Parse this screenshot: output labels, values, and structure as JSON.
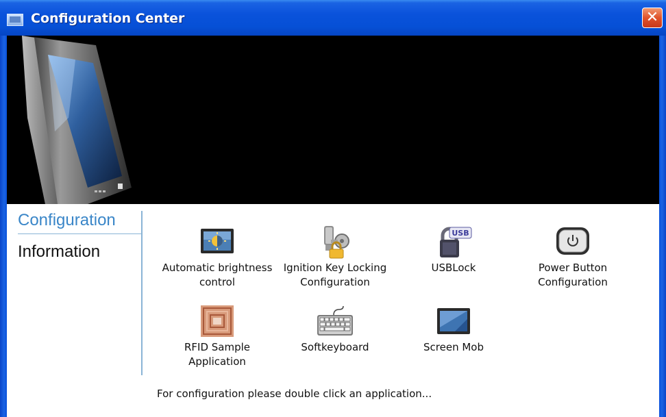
{
  "window": {
    "title": "Configuration Center",
    "close_glyph": "✕"
  },
  "nav": {
    "configuration": "Configuration",
    "information": "Information"
  },
  "apps": [
    {
      "label": "Automatic brightness\ncontrol",
      "icon": "brightness-icon"
    },
    {
      "label": "Ignition Key Locking\nConfiguration",
      "icon": "ignition-key-icon"
    },
    {
      "label": "USBLock",
      "icon": "usb-lock-icon"
    },
    {
      "label": "Power Button\nConfiguration",
      "icon": "power-button-icon"
    },
    {
      "label": "RFID Sample\nApplication",
      "icon": "rfid-icon"
    },
    {
      "label": "Softkeyboard",
      "icon": "keyboard-icon"
    },
    {
      "label": "Screen Mob",
      "icon": "screen-icon"
    }
  ],
  "status": {
    "hint": "For configuration please double click an application..."
  },
  "colors": {
    "titlebar": "#0a52db",
    "nav_active": "#3a86c8",
    "divider": "#8ab4d6",
    "close_button": "#e0532b"
  }
}
